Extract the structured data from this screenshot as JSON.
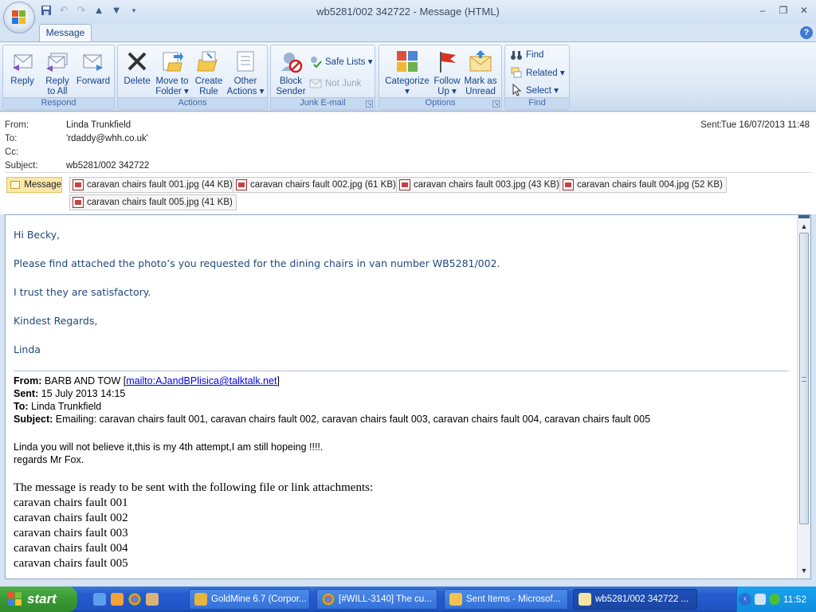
{
  "window": {
    "title": "wb5281/002 342722 - Message (HTML)",
    "minimize": "–",
    "restore": "❐",
    "close": "✕"
  },
  "ribbon": {
    "tab_message": "Message",
    "help": "?",
    "groups": {
      "respond": "Respond",
      "actions": "Actions",
      "junk": "Junk E-mail",
      "options": "Options",
      "find": "Find"
    },
    "buttons": {
      "reply": "Reply",
      "reply_all_1": "Reply",
      "reply_all_2": "to All",
      "forward": "Forward",
      "delete": "Delete",
      "move_1": "Move to",
      "move_2": "Folder ▾",
      "create_1": "Create",
      "create_2": "Rule",
      "other_1": "Other",
      "other_2": "Actions ▾",
      "block_1": "Block",
      "block_2": "Sender",
      "safe_lists": "Safe Lists ▾",
      "not_junk": "Not Junk",
      "categorize_1": "Categorize",
      "categorize_2": "▾",
      "followup_1": "Follow",
      "followup_2": "Up ▾",
      "mark_1": "Mark as",
      "mark_2": "Unread",
      "find": "Find",
      "related": "Related ▾",
      "select": "Select ▾"
    }
  },
  "header": {
    "from_label": "From:",
    "from_value": "Linda Trunkfield",
    "to_label": "To:",
    "to_value": "'rdaddy@whh.co.uk'",
    "cc_label": "Cc:",
    "cc_value": "",
    "subject_label": "Subject:",
    "subject_value": "wb5281/002 342722",
    "sent_label": "Sent:",
    "sent_value": "Tue 16/07/2013 11:48"
  },
  "attachments": {
    "message_tab": "Message",
    "files": [
      "caravan chairs fault 001.jpg (44 KB)",
      "caravan chairs fault 002.jpg (61 KB)",
      "caravan chairs fault 003.jpg (43 KB)",
      "caravan chairs fault 004.jpg (52 KB)",
      "caravan chairs fault 005.jpg (41 KB)"
    ]
  },
  "body": {
    "greeting": "Hi Becky,",
    "line1": "Please find attached the photo’s you requested for the dining chairs in van number WB5281/002.",
    "line2": "I trust they are satisfactory.",
    "closing": "Kindest Regards,",
    "signature": "Linda"
  },
  "forwarded": {
    "from_label": "From:",
    "from_name": "BARB AND TOW",
    "from_link": "mailto:AJandBPlisica@talktalk.net",
    "sent_label": "Sent:",
    "sent_value": "15 July 2013 14:15",
    "to_label": "To:",
    "to_value": "Linda Trunkfield",
    "subject_label": "Subject:",
    "subject_value": "Emailing: caravan chairs fault 001, caravan chairs fault 002, caravan chairs fault 003, caravan chairs fault 004, caravan chairs fault 005",
    "text1": "Linda you will not believe it,this is my 4th attempt,I am still hopeing !!!!.",
    "text2": "regards Mr Fox.",
    "ready": "The message is ready to be sent with the following file or link attachments:",
    "files": [
      "caravan chairs fault 001",
      "caravan chairs fault 002",
      "caravan chairs fault 003",
      "caravan chairs fault 004",
      "caravan chairs fault 005"
    ]
  },
  "taskbar": {
    "start": "start",
    "tasks": [
      "GoldMine 6.7 (Corpor...",
      "[#WILL-3140] The cu...",
      "Sent Items - Microsof...",
      "wb5281/002 342722 ..."
    ],
    "clock": "11:52"
  }
}
